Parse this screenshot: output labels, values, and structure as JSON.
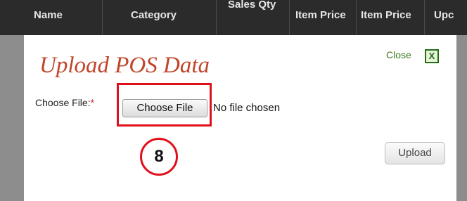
{
  "background_table": {
    "columns": [
      {
        "label": "Name"
      },
      {
        "label": "Category"
      },
      {
        "label": "Sales Qty"
      },
      {
        "label": "Item Price"
      },
      {
        "label": "Item Price"
      },
      {
        "label": "Upc"
      }
    ]
  },
  "modal": {
    "title": "Upload POS Data",
    "close_label": "Close",
    "close_button_glyph": "X",
    "file_field": {
      "label": "Choose File:",
      "required_marker": "*",
      "button_label": "Choose File",
      "status_text": "No file chosen"
    },
    "step_badge": "8",
    "upload_label": "Upload"
  },
  "colors": {
    "title": "#c0452a",
    "close": "#3d7a20",
    "highlight": "#e0101a",
    "header_bg": "#2b2b2b"
  }
}
